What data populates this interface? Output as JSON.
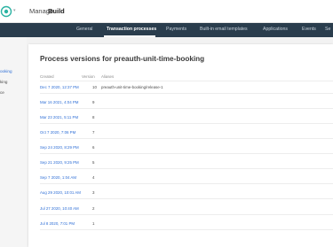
{
  "topnav": {
    "manage_label": "Manage",
    "build_label": "Build"
  },
  "tabs": [
    {
      "label": "General",
      "active": false
    },
    {
      "label": "Transaction processes",
      "active": true
    },
    {
      "label": "Payments",
      "active": false
    },
    {
      "label": "Built-in email templates",
      "active": false
    },
    {
      "label": "Applications",
      "active": false
    },
    {
      "label": "Events",
      "active": false
    },
    {
      "label": "Se",
      "active": false
    }
  ],
  "sidebar": {
    "items": [
      {
        "label": "ooking",
        "active": true
      },
      {
        "label": "king",
        "active": false
      },
      {
        "label": "ce",
        "active": false
      }
    ]
  },
  "main": {
    "title": "Process versions for preauth-unit-time-booking",
    "columns": {
      "created": "Created",
      "version": "Version",
      "aliases": "Aliases"
    },
    "rows": [
      {
        "created": "Dec 7 2020, 12:37 PM",
        "version": "10",
        "alias": "preauth-unit-time-booking/release-1"
      },
      {
        "created": "Mar 16 2021, 4:04 PM",
        "version": "9",
        "alias": ""
      },
      {
        "created": "Mar 23 2021, 5:11 PM",
        "version": "8",
        "alias": ""
      },
      {
        "created": "Oct 7 2020, 7:06 PM",
        "version": "7",
        "alias": ""
      },
      {
        "created": "Sep 24 2020, 8:29 PM",
        "version": "6",
        "alias": ""
      },
      {
        "created": "Sep 21 2020, 9:25 PM",
        "version": "5",
        "alias": ""
      },
      {
        "created": "Sep 7 2020, 1:04 AM",
        "version": "4",
        "alias": ""
      },
      {
        "created": "Aug 29 2020, 10:01 AM",
        "version": "3",
        "alias": ""
      },
      {
        "created": "Jul 27 2020, 10:40 AM",
        "version": "2",
        "alias": ""
      },
      {
        "created": "Jul 8 2020, 7:01 PM",
        "version": "1",
        "alias": ""
      }
    ]
  },
  "colors": {
    "tabbar_bg": "#2a3d4d",
    "link_blue": "#2f6fd6",
    "logo_teal": "#2bb3a3"
  },
  "icons": {
    "logo": "brand-logo-icon",
    "caret": "chevron-down-icon"
  }
}
